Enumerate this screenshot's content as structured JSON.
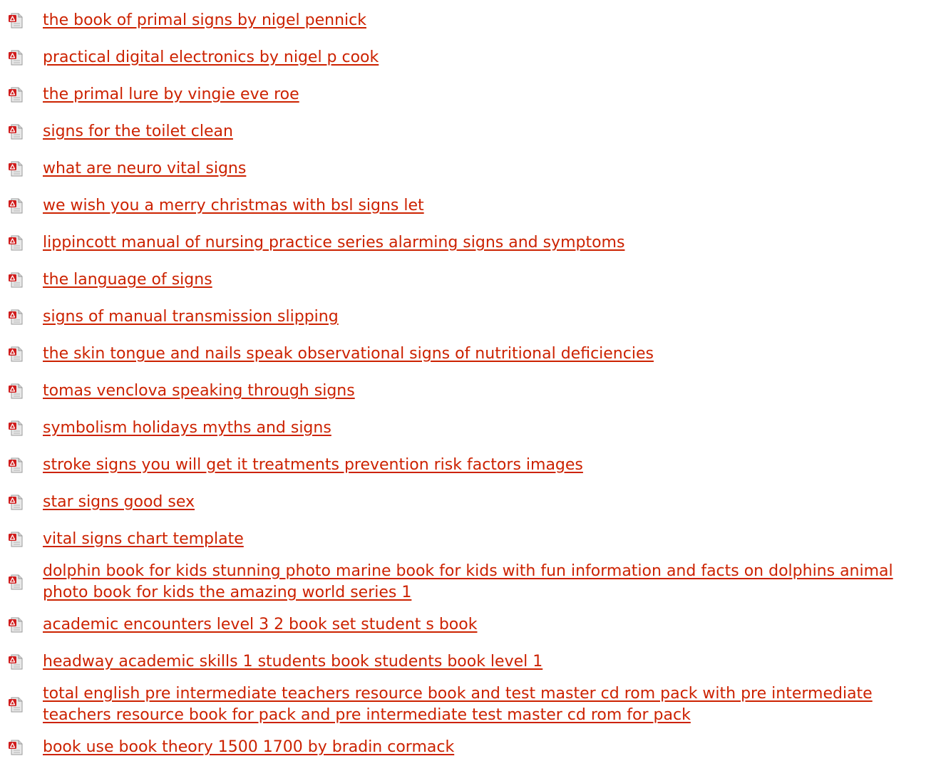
{
  "colors": {
    "link": "#cc2200",
    "icon_red": "#d01c1c",
    "icon_paper": "#e8e8e8"
  },
  "icon_name": "pdf-file-icon",
  "documents": [
    {
      "title": "the book of primal signs by nigel pennick"
    },
    {
      "title": "practical digital electronics by nigel p cook"
    },
    {
      "title": "the primal lure by vingie eve roe"
    },
    {
      "title": "signs for the toilet clean"
    },
    {
      "title": "what are neuro vital signs"
    },
    {
      "title": "we wish you a merry christmas with bsl signs let"
    },
    {
      "title": "lippincott manual of nursing practice series alarming signs and symptoms"
    },
    {
      "title": "the language of signs"
    },
    {
      "title": "signs of manual transmission slipping"
    },
    {
      "title": "the skin tongue and nails speak observational signs of nutritional deficiencies"
    },
    {
      "title": "tomas venclova speaking through signs"
    },
    {
      "title": "symbolism holidays myths and signs"
    },
    {
      "title": "stroke signs you will get it treatments prevention risk factors images"
    },
    {
      "title": "star signs good sex"
    },
    {
      "title": "vital signs chart template"
    },
    {
      "title": "dolphin book for kids stunning photo marine book for kids with fun information and facts on dolphins animal photo book for kids the amazing world series 1"
    },
    {
      "title": "academic encounters level 3 2 book set student s book"
    },
    {
      "title": "headway academic skills 1 students book students book level 1"
    },
    {
      "title": "total english pre intermediate teachers resource book and test master cd rom pack with pre intermediate teachers resource book for pack and pre intermediate test master cd rom for pack"
    },
    {
      "title": "book use book theory 1500 1700 by bradin cormack"
    }
  ]
}
